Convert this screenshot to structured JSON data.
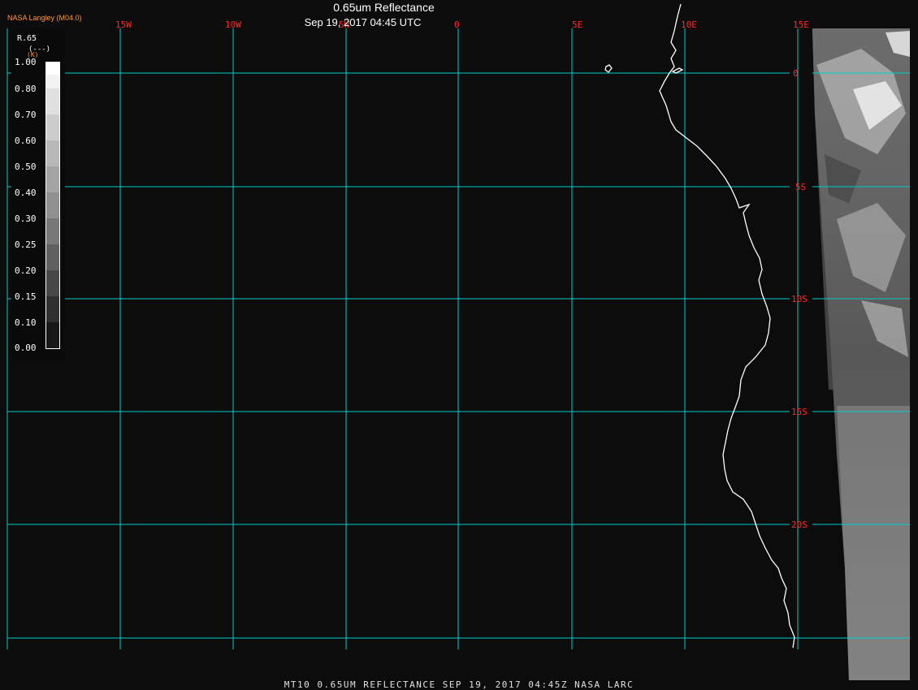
{
  "header": {
    "title": "0.65um Reflectance",
    "subtitle": "Sep 19, 2017 04:45 UTC",
    "producer": "NASA Langley (M04.0)"
  },
  "footer": {
    "text": "MT10  0.65UM REFLECTANCE   SEP 19, 2017 04:45Z   NASA LARC"
  },
  "legend": {
    "title": "R.65",
    "units": "(---)",
    "prefix": "(K)",
    "ticks": [
      "1.00",
      "0.80",
      "0.70",
      "0.60",
      "0.50",
      "0.40",
      "0.30",
      "0.25",
      "0.20",
      "0.15",
      "0.10",
      "0.00"
    ]
  },
  "grid": {
    "lon_labels": [
      "15W",
      "10W",
      "5W",
      "0",
      "5E",
      "10E",
      "15E"
    ],
    "lat_labels": [
      "0",
      "5S",
      "10S",
      "15S",
      "20S"
    ]
  },
  "colors": {
    "gridline": "#00cccc",
    "grid_label": "#ff2a2a",
    "coastline": "#ffffff",
    "background": "#0c0c0c",
    "producer": "#ff9933"
  }
}
